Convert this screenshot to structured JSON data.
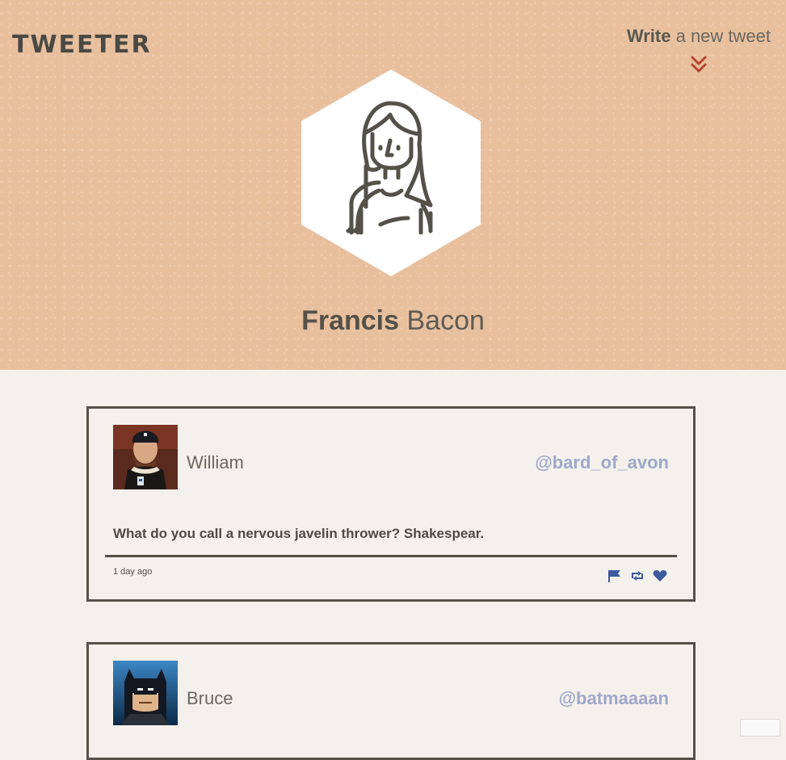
{
  "header": {
    "logo": "TWEETER",
    "compose": {
      "bold": "Write",
      "rest": " a new tweet",
      "chevron_icon": "double-chevron-down-icon"
    },
    "profile": {
      "avatar_icon": "user-avatar-icon",
      "first_name": "Francis",
      "last_name": " Bacon"
    }
  },
  "tweets": [
    {
      "author": "William",
      "handle": "@bard_of_avon",
      "body": "What do you call a nervous javelin thrower? Shakespear.",
      "time": "1 day ago",
      "actions": [
        "flag-icon",
        "retweet-icon",
        "heart-icon"
      ]
    },
    {
      "author": "Bruce",
      "handle": "@batmaaaan"
    }
  ],
  "colors": {
    "header_bg": "#e8bf9d",
    "page_bg": "#f4f1ec",
    "text_dark": "#545149",
    "handle": "#9fa7c9",
    "action_icon": "#3d5a9e",
    "chevron": "#b5452f"
  }
}
